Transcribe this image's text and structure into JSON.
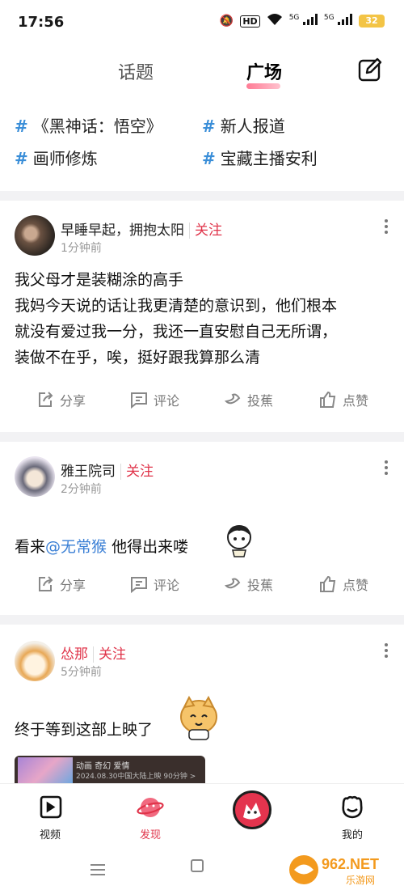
{
  "status": {
    "time": "17:56",
    "battery": "32",
    "hd_label": "HD",
    "net_label": "5G"
  },
  "header": {
    "tabs": [
      {
        "label": "话题"
      },
      {
        "label": "广场"
      }
    ],
    "edit_icon": "edit-icon"
  },
  "topics": [
    {
      "hash": "#",
      "label": "《黑神话：悟空》"
    },
    {
      "hash": "#",
      "label": "新人报道"
    },
    {
      "hash": "#",
      "label": "画师修炼"
    },
    {
      "hash": "#",
      "label": "宝藏主播安利"
    }
  ],
  "posts": [
    {
      "user": "早睡早起，拥抱太阳",
      "follow": "关注",
      "time": "1分钟前",
      "lines": [
        "我父母才是装糊涂的高手",
        "我妈今天说的话让我更清楚的意识到，他们根本",
        "就没有爱过我一分，我还一直安慰自己无所谓，",
        "装做不在乎，唉，挺好跟我算那么清"
      ]
    },
    {
      "user": "雅王院司",
      "follow": "关注",
      "time": "2分钟前",
      "text_before": "看来",
      "mention": "@无常猴",
      "text_after": " 他得出来喽"
    },
    {
      "user": "怂那",
      "follow": "关注",
      "time": "5分钟前",
      "text": "终于等到这部上映了",
      "media_title": "动画 奇幻 爱情",
      "media_sub": "2024.08.30中国大陆上映 90分钟 >"
    }
  ],
  "actions": {
    "share": "分享",
    "comment": "评论",
    "banana": "投蕉",
    "like": "点赞"
  },
  "nav": {
    "video": "视频",
    "discover": "发现",
    "mine": "我的"
  },
  "watermark": {
    "brand": "962.NET",
    "sub": "乐游网"
  },
  "colors": {
    "accent": "#e0344a",
    "link": "#3a7fd5"
  }
}
